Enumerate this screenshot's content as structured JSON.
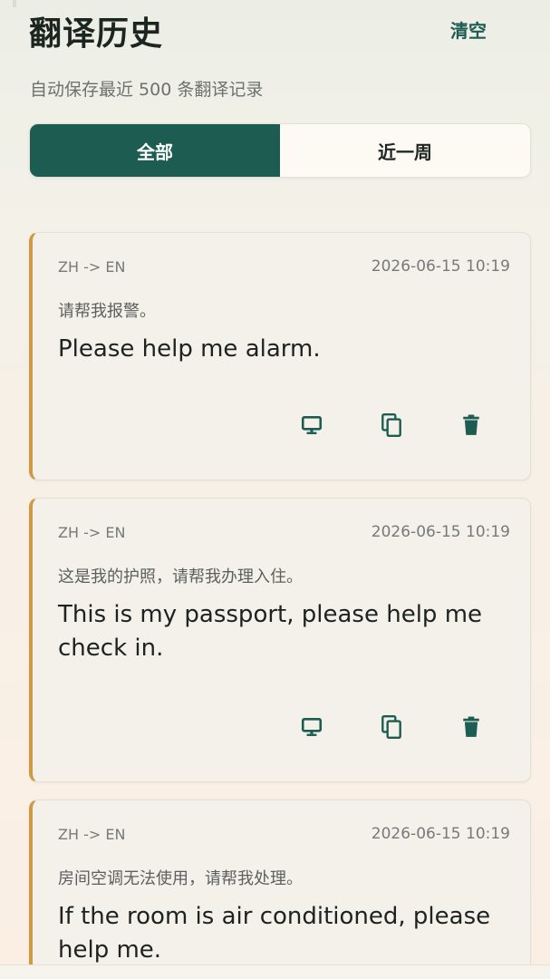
{
  "header": {
    "title": "翻译历史",
    "clear_label": "清空",
    "subtitle": "自动保存最近 500 条翻译记录"
  },
  "tabs": [
    {
      "label": "全部",
      "active": true
    },
    {
      "label": "近一周",
      "active": false
    }
  ],
  "history": [
    {
      "lang": "ZH -> EN",
      "time": "2026-06-15 10:19",
      "source": "请帮我报警。",
      "target": "Please help me alarm."
    },
    {
      "lang": "ZH -> EN",
      "time": "2026-06-15 10:19",
      "source": "这是我的护照，请帮我办理入住。",
      "target": "This is my passport, please help me check in."
    },
    {
      "lang": "ZH -> EN",
      "time": "2026-06-15 10:19",
      "source": "房间空调无法使用，请帮我处理。",
      "target": "If the room is air conditioned, please help me."
    }
  ],
  "icons": {
    "display": "monitor-icon",
    "copy": "copy-icon",
    "delete": "trash-icon"
  },
  "colors": {
    "primary": "#1d5c50",
    "accent_border": "#cf9a45",
    "card_bg": "#f3f1ea",
    "text_dark": "#1e2220",
    "text_muted": "#77797a"
  }
}
